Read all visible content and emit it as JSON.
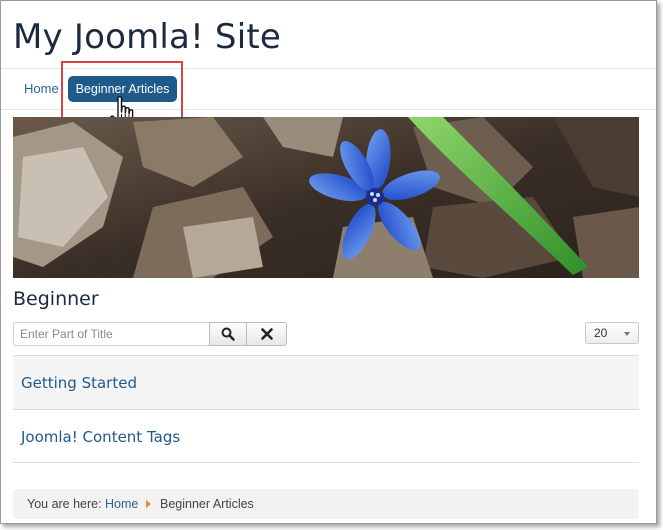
{
  "site": {
    "title": "My Joomla! Site"
  },
  "nav": {
    "items": [
      {
        "label": "Home"
      },
      {
        "label": "Beginner Articles"
      }
    ]
  },
  "category": {
    "title": "Beginner"
  },
  "filter": {
    "placeholder": "Enter Part of Title",
    "value": ""
  },
  "icons": {
    "search": "search-icon",
    "clear": "close-icon",
    "cursor": "hand-pointer-icon"
  },
  "limit": {
    "selected": "20"
  },
  "articles": [
    {
      "title": "Getting Started"
    },
    {
      "title": "Joomla! Content Tags"
    }
  ],
  "breadcrumb": {
    "label": "You are here:",
    "items": [
      "Home",
      "Beginner Articles"
    ]
  },
  "colors": {
    "accent": "#1e5b8a",
    "link": "#205a8c",
    "highlight": "#d9434a",
    "breadcrumb_separator": "#e8853a"
  }
}
